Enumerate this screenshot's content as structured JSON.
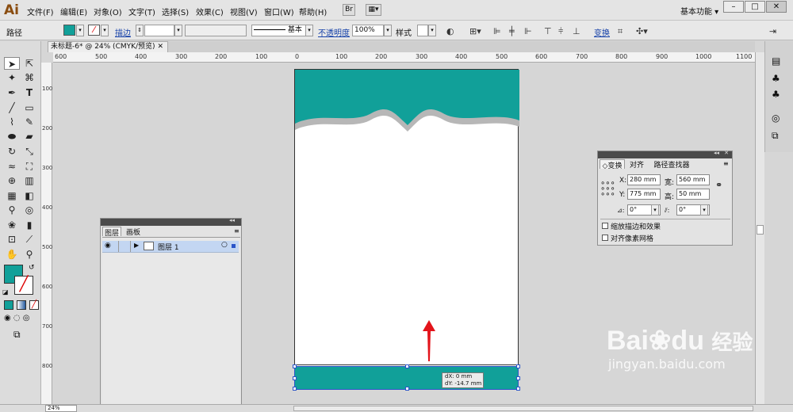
{
  "app": {
    "logo": "Ai",
    "menus": [
      "文件(F)",
      "编辑(E)",
      "对象(O)",
      "文字(T)",
      "选择(S)",
      "效果(C)",
      "视图(V)",
      "窗口(W)",
      "帮助(H)"
    ],
    "bridge": "Br",
    "workspace": "基本功能",
    "win_min": "–",
    "win_max": "□",
    "win_close": "✕"
  },
  "control": {
    "object_type": "路径",
    "stroke_label": "描边",
    "stroke_style": "基本",
    "opacity_label": "不透明度",
    "opacity_value": "100%",
    "style_label": "样式",
    "transform_link": "变换"
  },
  "document": {
    "tab_title": "未标题-6* @ 24% (CMYK/预览)",
    "zoom": "24%"
  },
  "rulers": {
    "h_ticks": [
      "600",
      "500",
      "400",
      "300",
      "200",
      "100",
      "0",
      "100",
      "200",
      "300",
      "400",
      "500",
      "600",
      "700",
      "800",
      "900",
      "1000",
      "1100"
    ],
    "v_ticks": [
      "100",
      "200",
      "300",
      "400",
      "500",
      "600",
      "700",
      "800"
    ]
  },
  "colors": {
    "teal": "#11a099",
    "shadow": "#b7b7b7",
    "arrow": "#e3141b",
    "selection": "#2c55c8"
  },
  "tooltip": {
    "dx": "dX: 0 mm",
    "dy": "dY: -14.7 mm"
  },
  "layers_panel": {
    "tab_layers": "图层",
    "tab_artboards": "画板",
    "layer_name": "图层 1",
    "collapse": "◂◂",
    "close": "✕"
  },
  "transform_panel": {
    "tabs": [
      "◇变换",
      "对齐",
      "路径查找器"
    ],
    "x_label": "X:",
    "x_value": "280 mm",
    "w_label": "宽:",
    "w_value": "560 mm",
    "y_label": "Y:",
    "y_value": "775 mm",
    "h_label": "高:",
    "h_value": "50 mm",
    "angle_value": "0°",
    "shear_value": "0°",
    "scale_strokes": "缩放描边和效果",
    "align_pixel": "对齐像素网格"
  },
  "watermark": {
    "brand": "Bai",
    "brand2": "du",
    "brand3": "经验",
    "url": "jingyan.baidu.com"
  }
}
